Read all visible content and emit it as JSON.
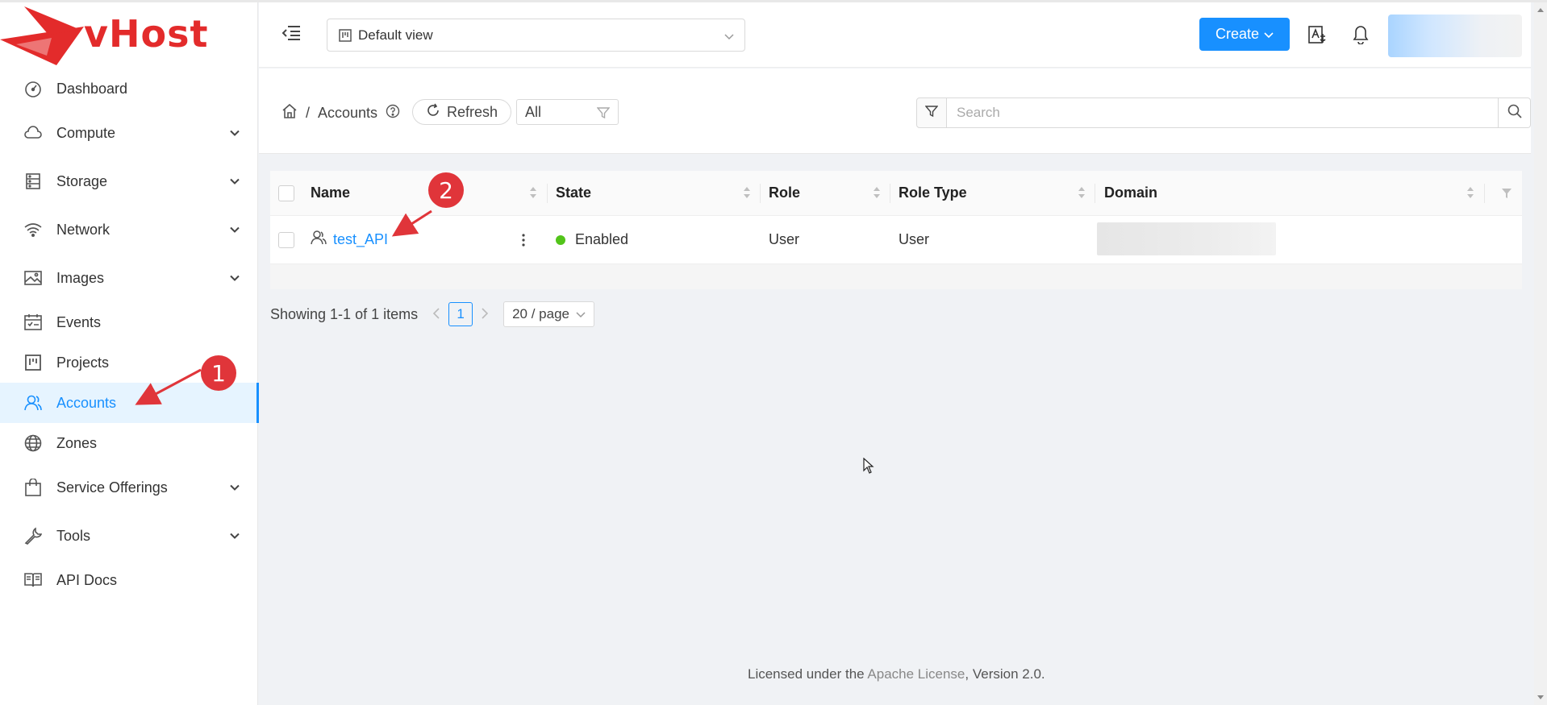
{
  "brand": {
    "name": "vHost",
    "color": "#e32b2b"
  },
  "accent_color": "#1890ff",
  "sidebar": {
    "items": [
      {
        "label": "Dashboard",
        "icon": "dashboard-icon",
        "expandable": false,
        "active": false
      },
      {
        "label": "Compute",
        "icon": "cloud-icon",
        "expandable": true,
        "active": false
      },
      {
        "label": "Storage",
        "icon": "storage-icon",
        "expandable": true,
        "active": false
      },
      {
        "label": "Network",
        "icon": "wifi-icon",
        "expandable": true,
        "active": false
      },
      {
        "label": "Images",
        "icon": "image-icon",
        "expandable": true,
        "active": false
      },
      {
        "label": "Events",
        "icon": "calendar-icon",
        "expandable": false,
        "active": false
      },
      {
        "label": "Projects",
        "icon": "project-icon",
        "expandable": false,
        "active": false
      },
      {
        "label": "Accounts",
        "icon": "users-icon",
        "expandable": false,
        "active": true
      },
      {
        "label": "Zones",
        "icon": "globe-icon",
        "expandable": false,
        "active": false
      },
      {
        "label": "Service Offerings",
        "icon": "shopping-bag-icon",
        "expandable": true,
        "active": false
      },
      {
        "label": "Tools",
        "icon": "tool-icon",
        "expandable": true,
        "active": false
      },
      {
        "label": "API Docs",
        "icon": "book-icon",
        "expandable": false,
        "active": false
      }
    ]
  },
  "header": {
    "view_select": "Default view",
    "create_label": "Create"
  },
  "toolbar": {
    "breadcrumb_current": "Accounts",
    "breadcrumb_separator": "/",
    "refresh_label": "Refresh",
    "filter_value": "All",
    "search_placeholder": "Search"
  },
  "table": {
    "columns": [
      "Name",
      "State",
      "Role",
      "Role Type",
      "Domain"
    ],
    "rows": [
      {
        "name": "test_API",
        "state": "Enabled",
        "role": "User",
        "role_type": "User",
        "domain": ""
      }
    ]
  },
  "pagination": {
    "summary": "Showing 1-1 of 1 items",
    "current_page": "1",
    "page_size": "20 / page"
  },
  "footer": {
    "prefix": "Licensed under the ",
    "link": "Apache License",
    "suffix": ", Version 2.0."
  },
  "annotations": [
    "1",
    "2"
  ]
}
